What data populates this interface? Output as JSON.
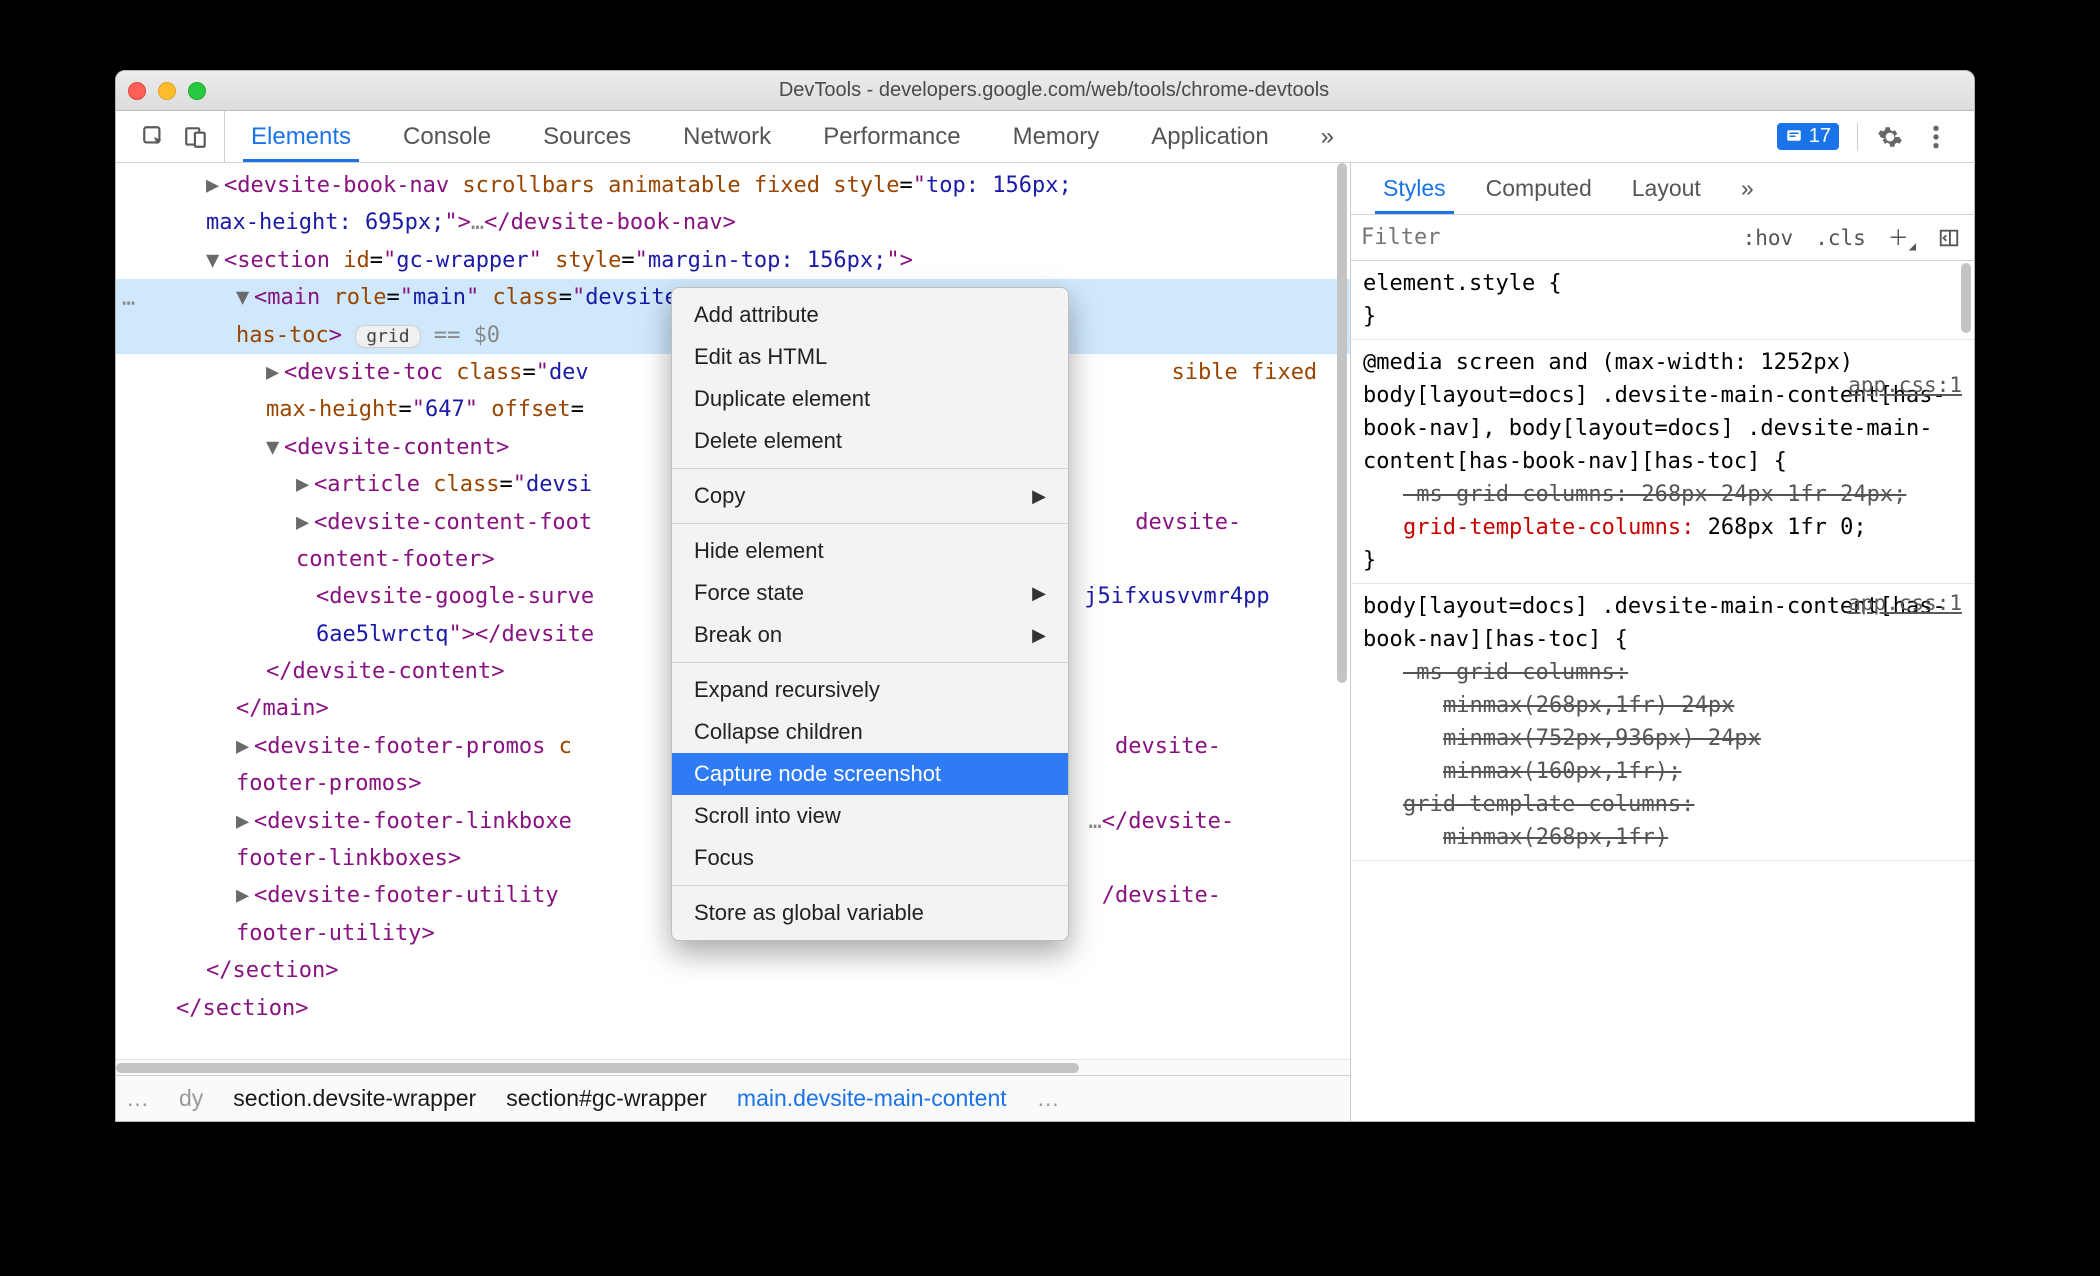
{
  "window": {
    "title": "DevTools - developers.google.com/web/tools/chrome-devtools"
  },
  "tabs": {
    "items": [
      "Elements",
      "Console",
      "Sources",
      "Network",
      "Performance",
      "Memory",
      "Application"
    ],
    "active": 0,
    "overflow": "»",
    "error_count": "17"
  },
  "tree": {
    "l1_open": "<devsite-book-nav scrollbars animatable fixed style=\"top: 156px; max-height: 695px;\">…</devsite-book-nav>",
    "l2": {
      "tag": "section",
      "id": "gc-wrapper",
      "style": "margin-top: 156px;"
    },
    "l3": {
      "tag": "main",
      "role": "main",
      "class": "devsite-main-content",
      "extra": " has-book-nav has-toc",
      "chip": "grid",
      "eq": " == $0"
    },
    "l4a": "<devsite-toc class=\"devsite-toc\" max-height=\"647\" offset=",
    "l4a_tail": "sible fixed",
    "l4a_line2": "max-height=\"647\" offset=",
    "l5": "devsite-content",
    "l6a": "<article class=\"devsi",
    "l6b": "<devsite-content-foot",
    "l6b_tail": "devsite-content-footer>",
    "l7": "<devsite-google-surve",
    "l7_tail": "j5ifxusvvmr4pp",
    "l7b": "6ae5lwrctq\"></devsite",
    "l8": "</devsite-content>",
    "l9": "</main>",
    "l10": "<devsite-footer-promos c",
    "l10_tail": "devsite-footer-promos>",
    "l11": "<devsite-footer-linkboxe",
    "l11_tail": "…</devsite-footer-linkboxes>",
    "l12": "<devsite-footer-utility",
    "l12_tail": "/devsite-footer-utility>",
    "l13": "</section>",
    "l14": "</section>"
  },
  "breadcrumbs": {
    "left_ell": "…",
    "b1": "dy",
    "b2": "section.devsite-wrapper",
    "b3": "section#gc-wrapper",
    "b4": "main.devsite-main-content",
    "right_ell": "…"
  },
  "ctx": {
    "items": [
      {
        "label": "Add attribute"
      },
      {
        "label": "Edit as HTML"
      },
      {
        "label": "Duplicate element"
      },
      {
        "label": "Delete element"
      },
      {
        "sep": true
      },
      {
        "label": "Copy",
        "sub": true
      },
      {
        "sep": true
      },
      {
        "label": "Hide element"
      },
      {
        "label": "Force state",
        "sub": true
      },
      {
        "label": "Break on",
        "sub": true
      },
      {
        "sep": true
      },
      {
        "label": "Expand recursively"
      },
      {
        "label": "Collapse children"
      },
      {
        "label": "Capture node screenshot",
        "sel": true
      },
      {
        "label": "Scroll into view"
      },
      {
        "label": "Focus"
      },
      {
        "sep": true
      },
      {
        "label": "Store as global variable"
      }
    ]
  },
  "styles": {
    "tabs": [
      "Styles",
      "Computed",
      "Layout"
    ],
    "overflow": "»",
    "filter_placeholder": "Filter",
    "hov": ":hov",
    "cls": ".cls",
    "rule0": {
      "sel": "element.style {",
      "close": "}"
    },
    "rule1": {
      "mq": "@media screen and (max-width: 1252px)",
      "sel": "body[layout=docs] .devsite-main-content[has-book-nav], body[layout=docs] .devsite-main-content[has-book-nav][has-toc] {",
      "src": "app.css:1",
      "p1": "-ms-grid-columns: 268px 24px 1fr 24px;",
      "p2n": "grid-template-columns:",
      "p2v": "268px 1fr 0;",
      "close": "}"
    },
    "rule2": {
      "sel": "body[layout=docs] .devsite-main-content[has-book-nav][has-toc] {",
      "src": "app.css:1",
      "p1": "-ms-grid-columns:",
      "p1b": "minmax(268px,1fr) 24px",
      "p1c": "minmax(752px,936px) 24px",
      "p1d": "minmax(160px,1fr);",
      "p2": "grid-template-columns:",
      "p2b": "minmax(268px,1fr)"
    }
  }
}
